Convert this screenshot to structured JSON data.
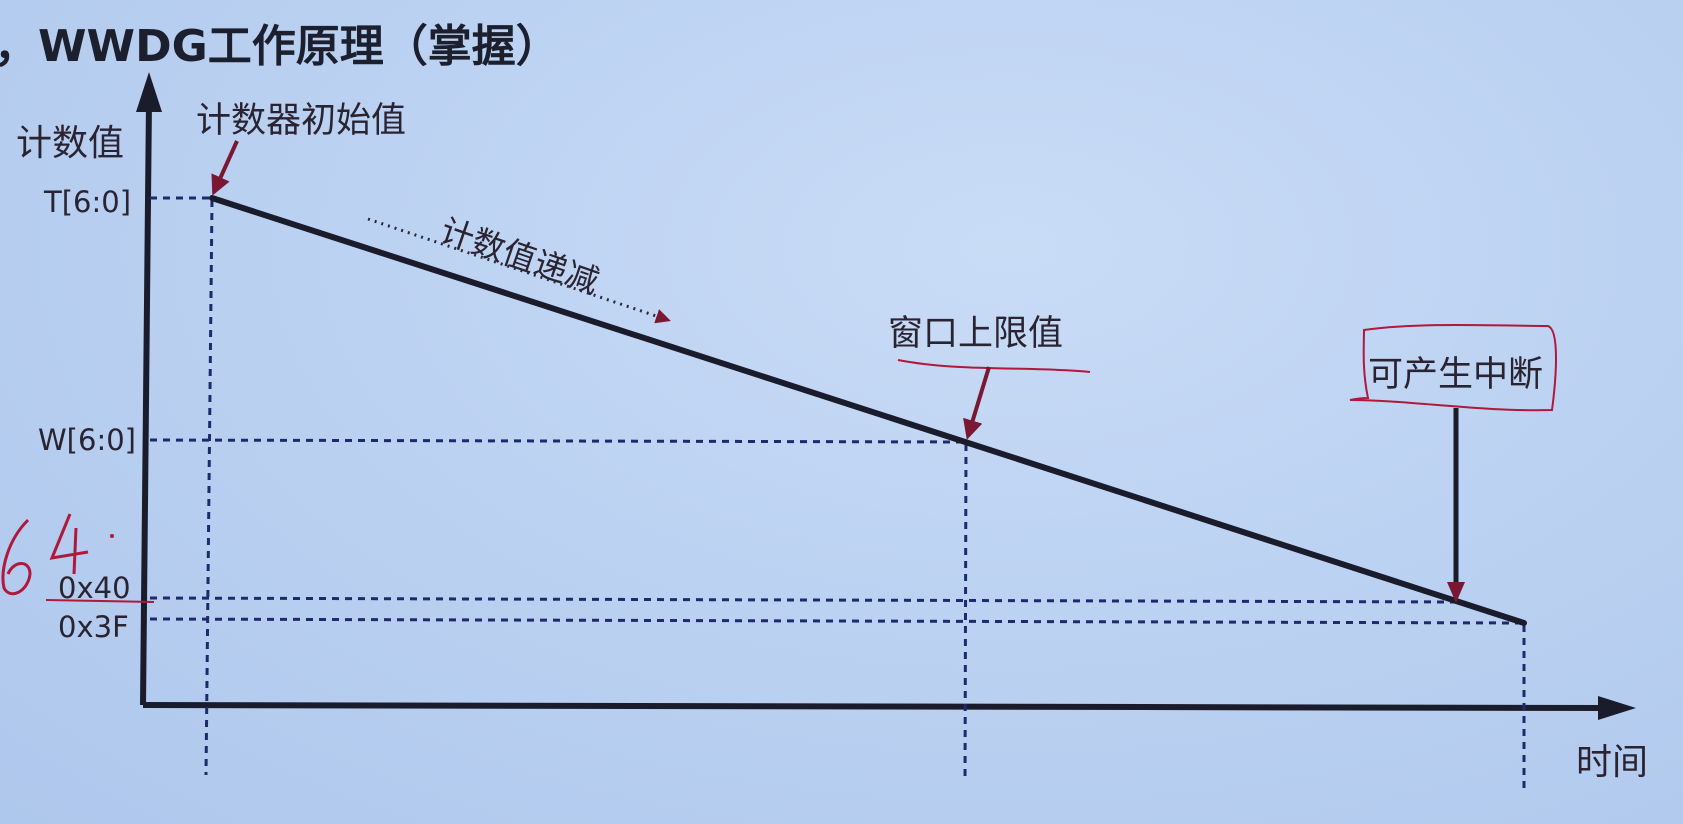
{
  "title": "，WWDG工作原理（掌握）",
  "diagram": {
    "y_axis_label": "计数值",
    "x_axis_label": "时间",
    "tick_labels": {
      "t": "T[6:0]",
      "w": "W[6:0]",
      "hex40": "0x40",
      "hex3f": "0x3F"
    },
    "annotations": {
      "initial_value": "计数器初始值",
      "decrement": "计数值递减",
      "window_upper": "窗口上限值",
      "interrupt": "可产生中断"
    },
    "handwritten_note": "64",
    "colors": {
      "line": "#1a1c2c",
      "dash": "#1f2a6e",
      "annotation_arrow": "#7a1834",
      "handwriting_red": "#b0183c",
      "text": "#2a2432"
    }
  }
}
